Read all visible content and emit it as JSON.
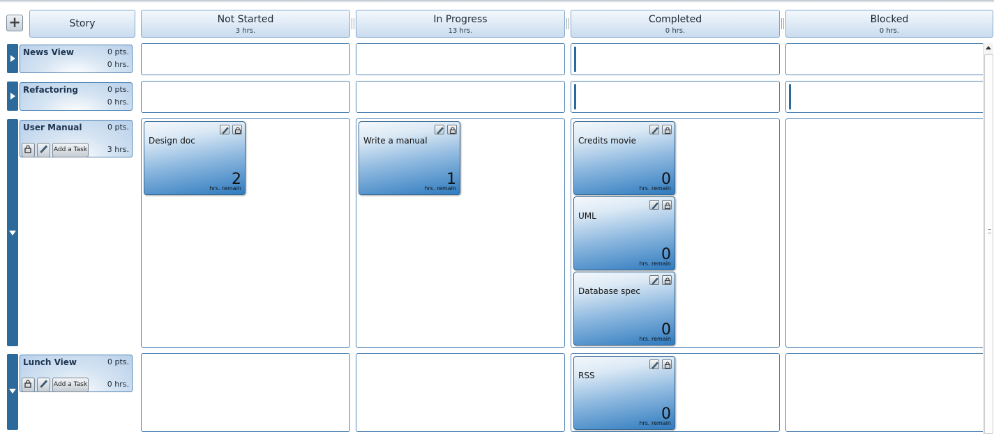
{
  "header": {
    "add_symbol": "+",
    "story_label": "Story",
    "columns": [
      {
        "title": "Not Started",
        "hours": "3 hrs."
      },
      {
        "title": "In Progress",
        "hours": "13 hrs."
      },
      {
        "title": "Completed",
        "hours": "0 hrs."
      },
      {
        "title": "Blocked",
        "hours": "0 hrs."
      }
    ]
  },
  "stories": [
    {
      "name": "News View",
      "points": "0 pts.",
      "hours": "0 hrs."
    },
    {
      "name": "Refactoring",
      "points": "0 pts.",
      "hours": "0 hrs."
    },
    {
      "name": "User Manual",
      "points": "0 pts.",
      "hours": "3 hrs.",
      "add_task_label": "Add a Task"
    },
    {
      "name": "Lunch View",
      "points": "0 pts.",
      "hours": "0 hrs.",
      "add_task_label": "Add a Task"
    }
  ],
  "tasks": {
    "remain_label": "hrs. remain",
    "items": [
      {
        "name": "Design doc",
        "remaining": "2",
        "status": "Not Started",
        "story": "User Manual"
      },
      {
        "name": "Write a manual",
        "remaining": "1",
        "status": "In Progress",
        "story": "User Manual"
      },
      {
        "name": "Credits movie",
        "remaining": "0",
        "status": "Completed",
        "story": "User Manual"
      },
      {
        "name": "UML",
        "remaining": "0",
        "status": "Completed",
        "story": "User Manual"
      },
      {
        "name": "Database spec",
        "remaining": "0",
        "status": "Completed",
        "story": "User Manual"
      },
      {
        "name": "RSS",
        "remaining": "0",
        "status": "Completed",
        "story": "Lunch View"
      }
    ]
  },
  "colors": {
    "accent": "#2d6a9c",
    "border": "#4f83b3",
    "card_bottom": "#2f7bbf"
  },
  "icons": [
    "plus-icon",
    "pencil-icon",
    "lock-icon",
    "expand-arrow-icon",
    "collapse-arrow-icon"
  ]
}
